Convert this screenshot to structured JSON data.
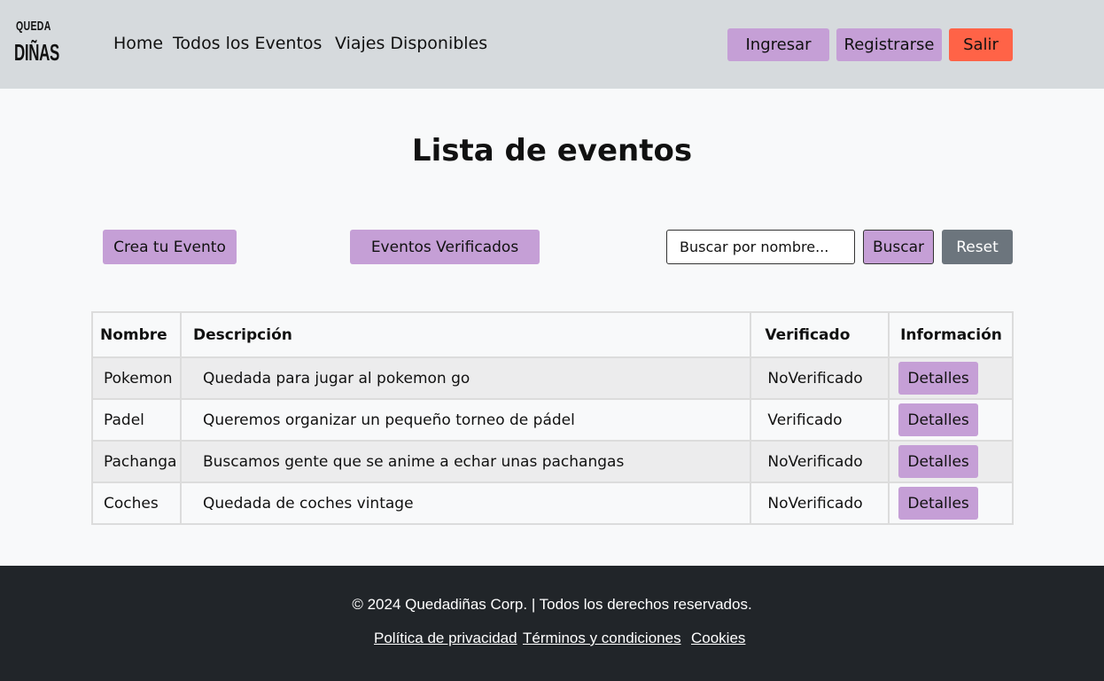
{
  "header": {
    "logo_top": "QUEDA",
    "logo_bottom": "DIÑAS",
    "nav": [
      "Home",
      "Todos los Eventos",
      "Viajes Disponibles"
    ],
    "login_label": "Ingresar",
    "register_label": "Registrarse",
    "logout_label": "Salir"
  },
  "main": {
    "title": "Lista de eventos",
    "create_label": "Crea tu Evento",
    "verified_label": "Eventos Verificados",
    "search_placeholder": "Buscar por nombre...",
    "search_label": "Buscar",
    "reset_label": "Reset"
  },
  "table": {
    "columns": [
      "Nombre",
      "Descripción",
      "Verificado",
      "Información"
    ],
    "rows": [
      {
        "name": "Pokemon",
        "description": "Quedada para jugar al pokemon go",
        "verified": "NoVerificado",
        "action": "Detalles"
      },
      {
        "name": "Padel",
        "description": "Queremos organizar un pequeño torneo de pádel",
        "verified": "Verificado",
        "action": "Detalles"
      },
      {
        "name": "Pachanga",
        "description": "Buscamos gente que se anime a echar unas pachangas",
        "verified": "NoVerificado",
        "action": "Detalles"
      },
      {
        "name": "Coches",
        "description": "Quedada de coches vintage",
        "verified": "NoVerificado",
        "action": "Detalles"
      }
    ]
  },
  "footer": {
    "copyright": "© 2024 Quedadiñas Corp. | Todos los derechos reservados.",
    "links": [
      "Política de privacidad",
      "Términos y condiciones",
      "Cookies"
    ]
  },
  "colors": {
    "header_bg": "#d6dadd",
    "accent_lilac": "#c59fd6",
    "logout_orange": "#ff6347",
    "reset_gray": "#6c757d",
    "footer_bg": "#212529"
  }
}
